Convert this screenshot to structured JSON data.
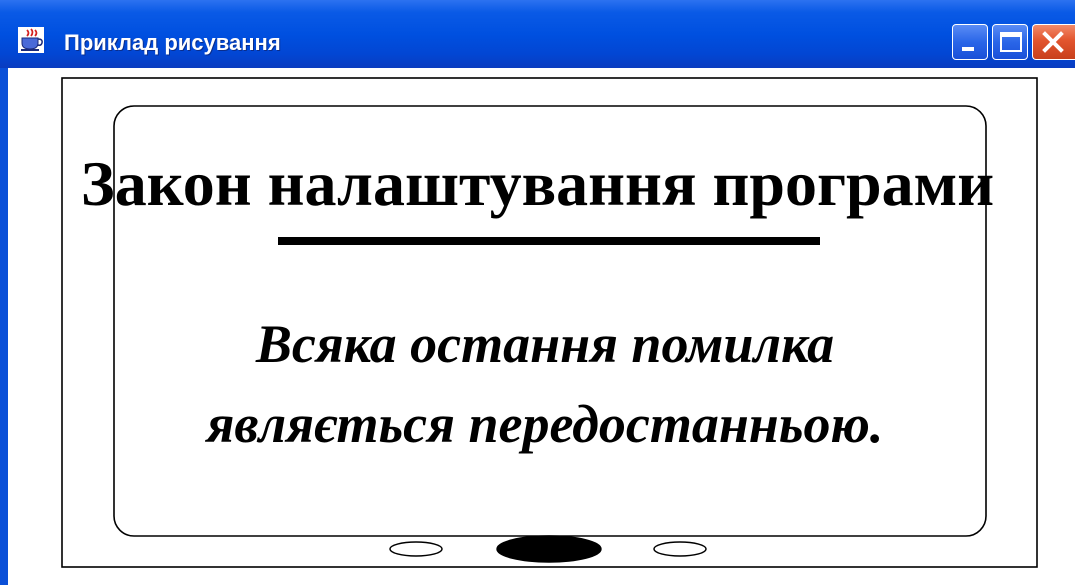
{
  "window": {
    "title": "Приклад рисування",
    "controls": {
      "minimize": "minimize-icon",
      "maximize": "maximize-icon",
      "close": "close-icon"
    }
  },
  "drawing": {
    "heading": "Закон налаштування програми",
    "quote_line_1": "Всяка остання помилка",
    "quote_line_2": "являється передостанньою."
  }
}
